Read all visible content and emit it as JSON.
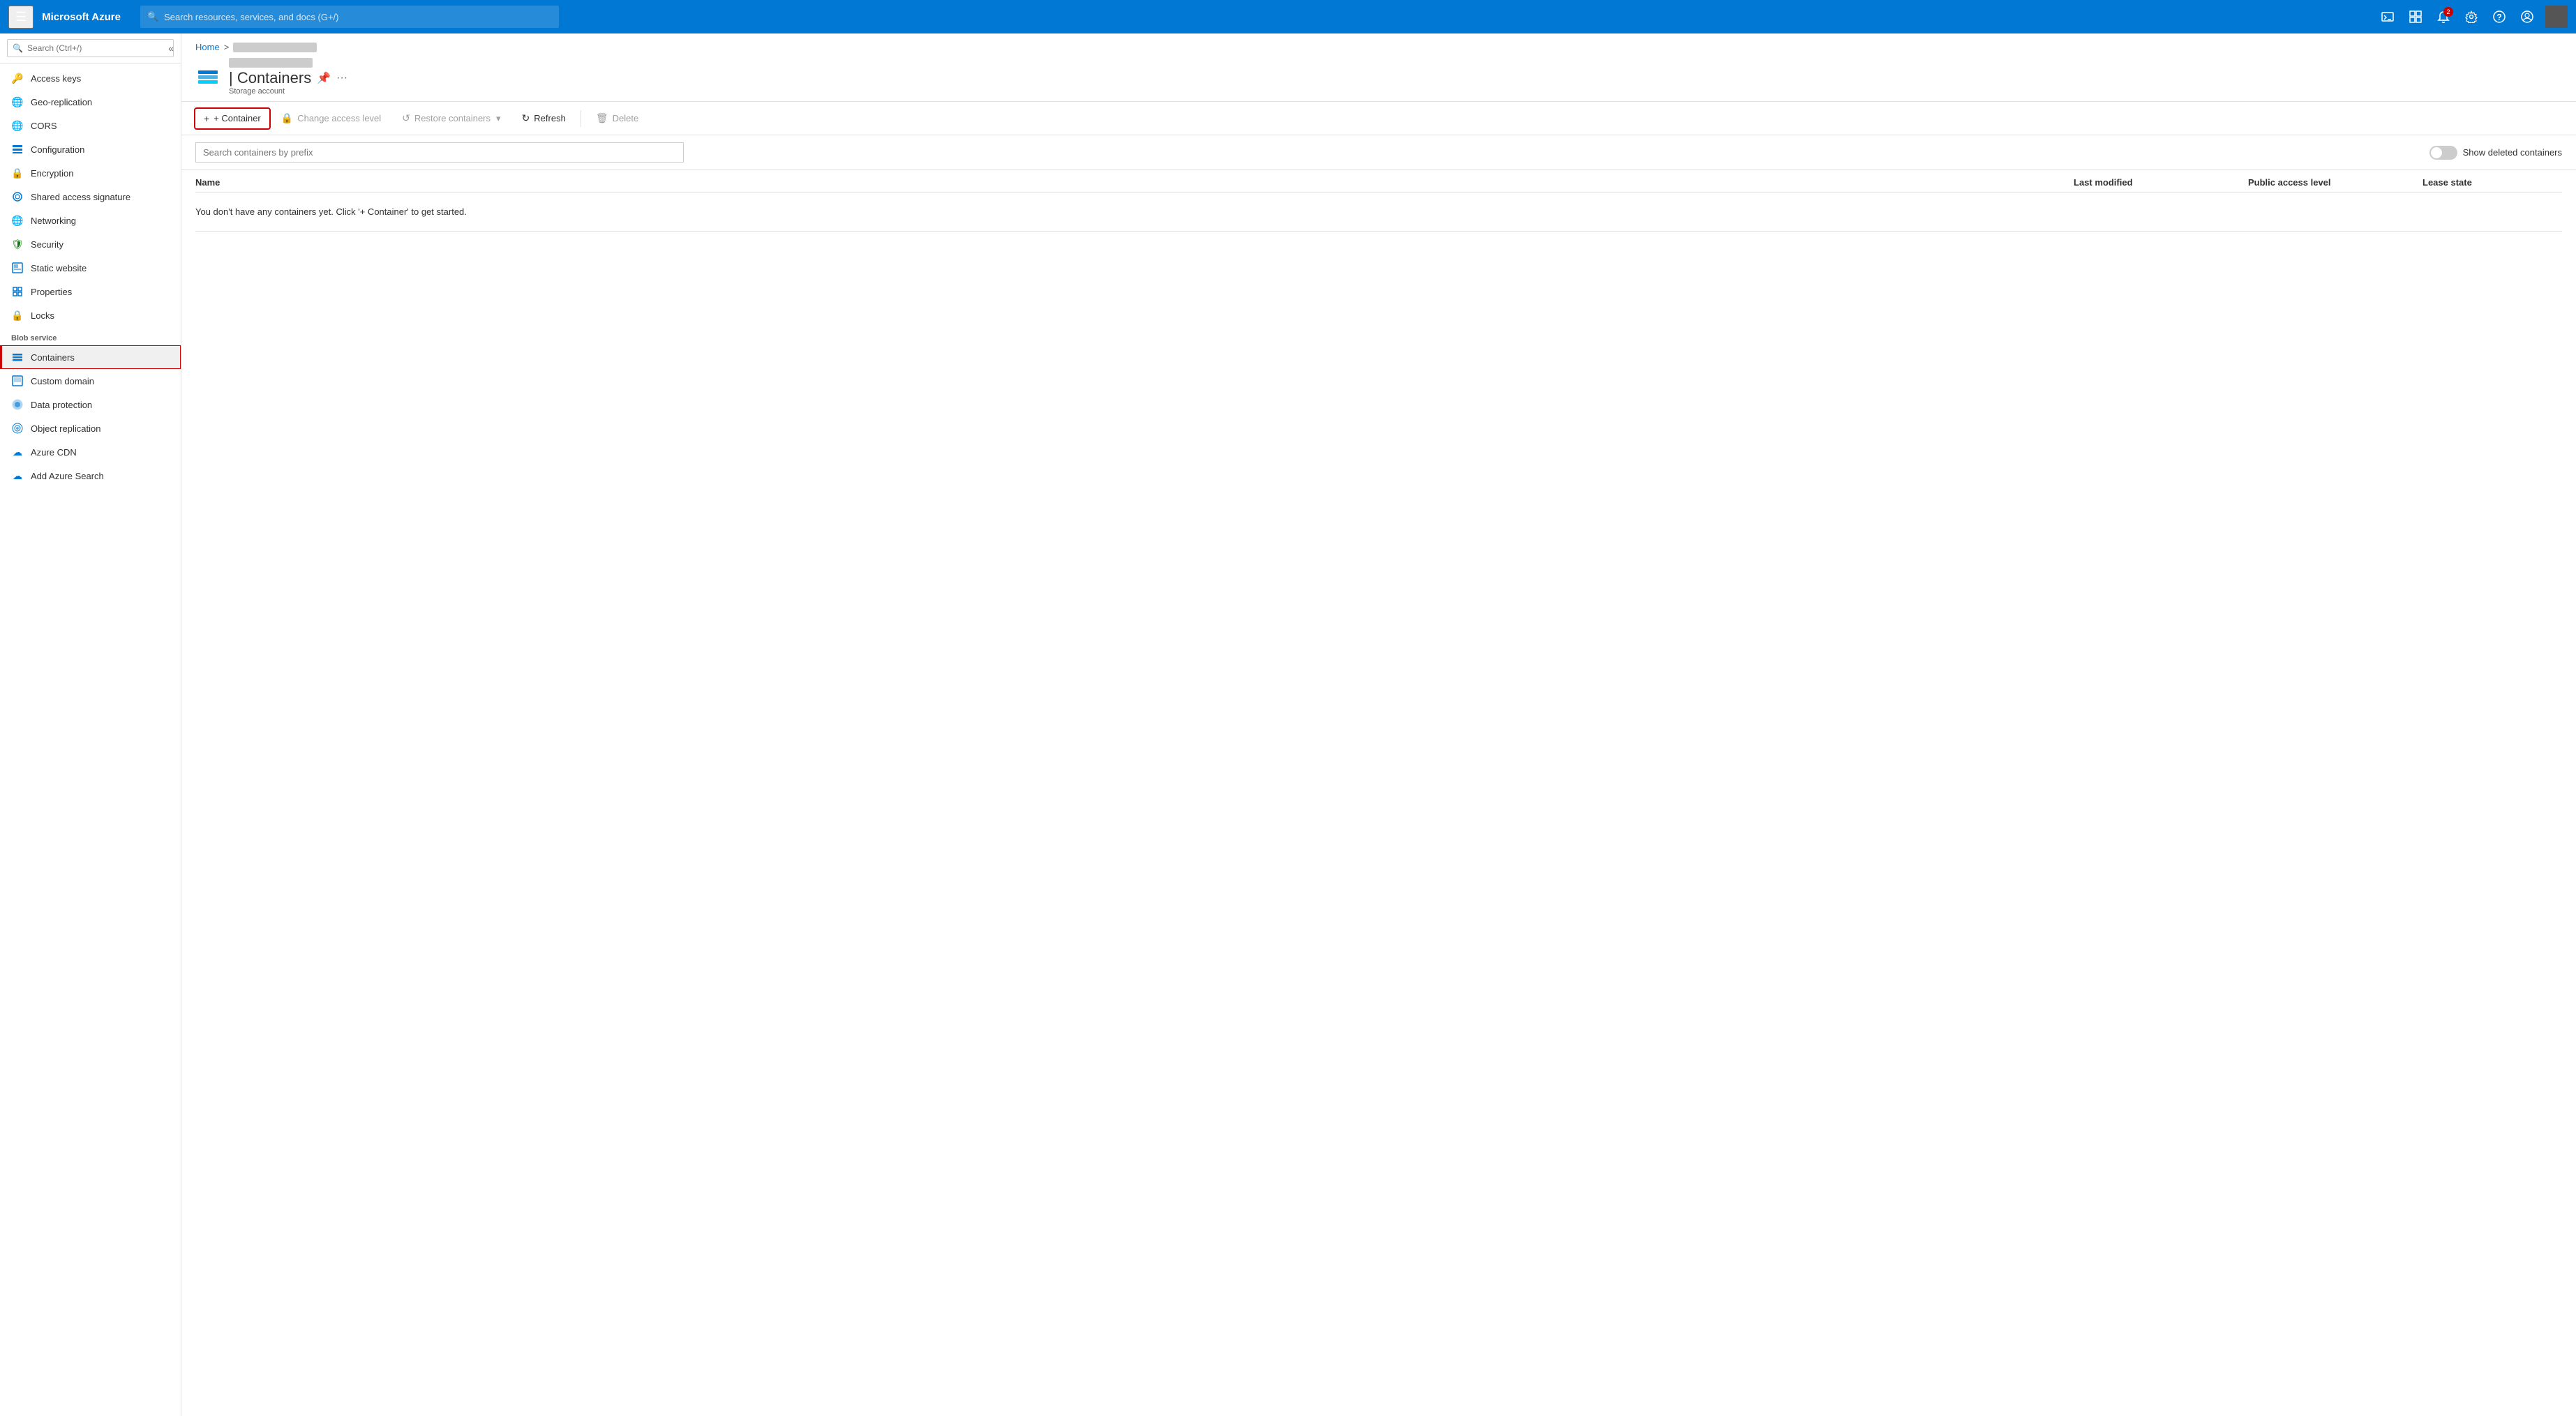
{
  "topbar": {
    "hamburger_label": "☰",
    "logo": "Microsoft Azure",
    "search_placeholder": "Search resources, services, and docs (G+/)",
    "icons": [
      {
        "name": "cloud-shell-icon",
        "symbol": "⌨",
        "badge": null
      },
      {
        "name": "feedback-icon",
        "symbol": "⊡",
        "badge": null
      },
      {
        "name": "notifications-icon",
        "symbol": "🔔",
        "badge": "2"
      },
      {
        "name": "settings-icon",
        "symbol": "⚙",
        "badge": null
      },
      {
        "name": "help-icon",
        "symbol": "?",
        "badge": null
      },
      {
        "name": "account-icon",
        "symbol": "😊",
        "badge": null
      }
    ]
  },
  "breadcrumb": {
    "home": "Home",
    "separator": ">",
    "account": ""
  },
  "page_header": {
    "title": "| Containers",
    "subtitle": "Storage account",
    "pin_symbol": "📌",
    "more_symbol": "···"
  },
  "sidebar": {
    "search_placeholder": "Search (Ctrl+/)",
    "items": [
      {
        "id": "access-keys",
        "label": "Access keys",
        "icon": "🔑",
        "color": "#eaa"
      },
      {
        "id": "geo-replication",
        "label": "Geo-replication",
        "icon": "🌐",
        "color": "#0078d4"
      },
      {
        "id": "cors",
        "label": "CORS",
        "icon": "🌐",
        "color": "#0078d4"
      },
      {
        "id": "configuration",
        "label": "Configuration",
        "icon": "⚙",
        "color": "#0078d4"
      },
      {
        "id": "encryption",
        "label": "Encryption",
        "icon": "🔒",
        "color": "#0078d4"
      },
      {
        "id": "shared-access-signature",
        "label": "Shared access signature",
        "icon": "🔗",
        "color": "#0078d4"
      },
      {
        "id": "networking",
        "label": "Networking",
        "icon": "🌐",
        "color": "#00b0f0"
      },
      {
        "id": "security",
        "label": "Security",
        "icon": "🛡",
        "color": "#107c10"
      },
      {
        "id": "static-website",
        "label": "Static website",
        "icon": "⬛",
        "color": "#0078d4"
      },
      {
        "id": "properties",
        "label": "Properties",
        "icon": "📋",
        "color": "#0078d4"
      },
      {
        "id": "locks",
        "label": "Locks",
        "icon": "🔒",
        "color": "#0078d4"
      }
    ],
    "blob_section_label": "Blob service",
    "blob_items": [
      {
        "id": "containers",
        "label": "Containers",
        "icon": "≡",
        "color": "#0078d4",
        "active": true
      },
      {
        "id": "custom-domain",
        "label": "Custom domain",
        "icon": "⬛",
        "color": "#0078d4"
      },
      {
        "id": "data-protection",
        "label": "Data protection",
        "icon": "🔵",
        "color": "#0078d4"
      },
      {
        "id": "object-replication",
        "label": "Object replication",
        "icon": "🔵",
        "color": "#0078d4"
      },
      {
        "id": "azure-cdn",
        "label": "Azure CDN",
        "icon": "☁",
        "color": "#0078d4"
      },
      {
        "id": "add-azure-search",
        "label": "Add Azure Search",
        "icon": "☁",
        "color": "#0078d4"
      }
    ]
  },
  "toolbar": {
    "add_container_label": "+ Container",
    "change_access_label": "Change access level",
    "restore_containers_label": "Restore containers",
    "refresh_label": "Refresh",
    "delete_label": "Delete"
  },
  "search_bar": {
    "placeholder": "Search containers by prefix",
    "show_deleted_label": "Show deleted containers",
    "toggle_state": false
  },
  "table": {
    "columns": [
      "Name",
      "Last modified",
      "Public access level",
      "Lease state"
    ],
    "empty_message": "You don't have any containers yet. Click '+ Container' to get started."
  }
}
